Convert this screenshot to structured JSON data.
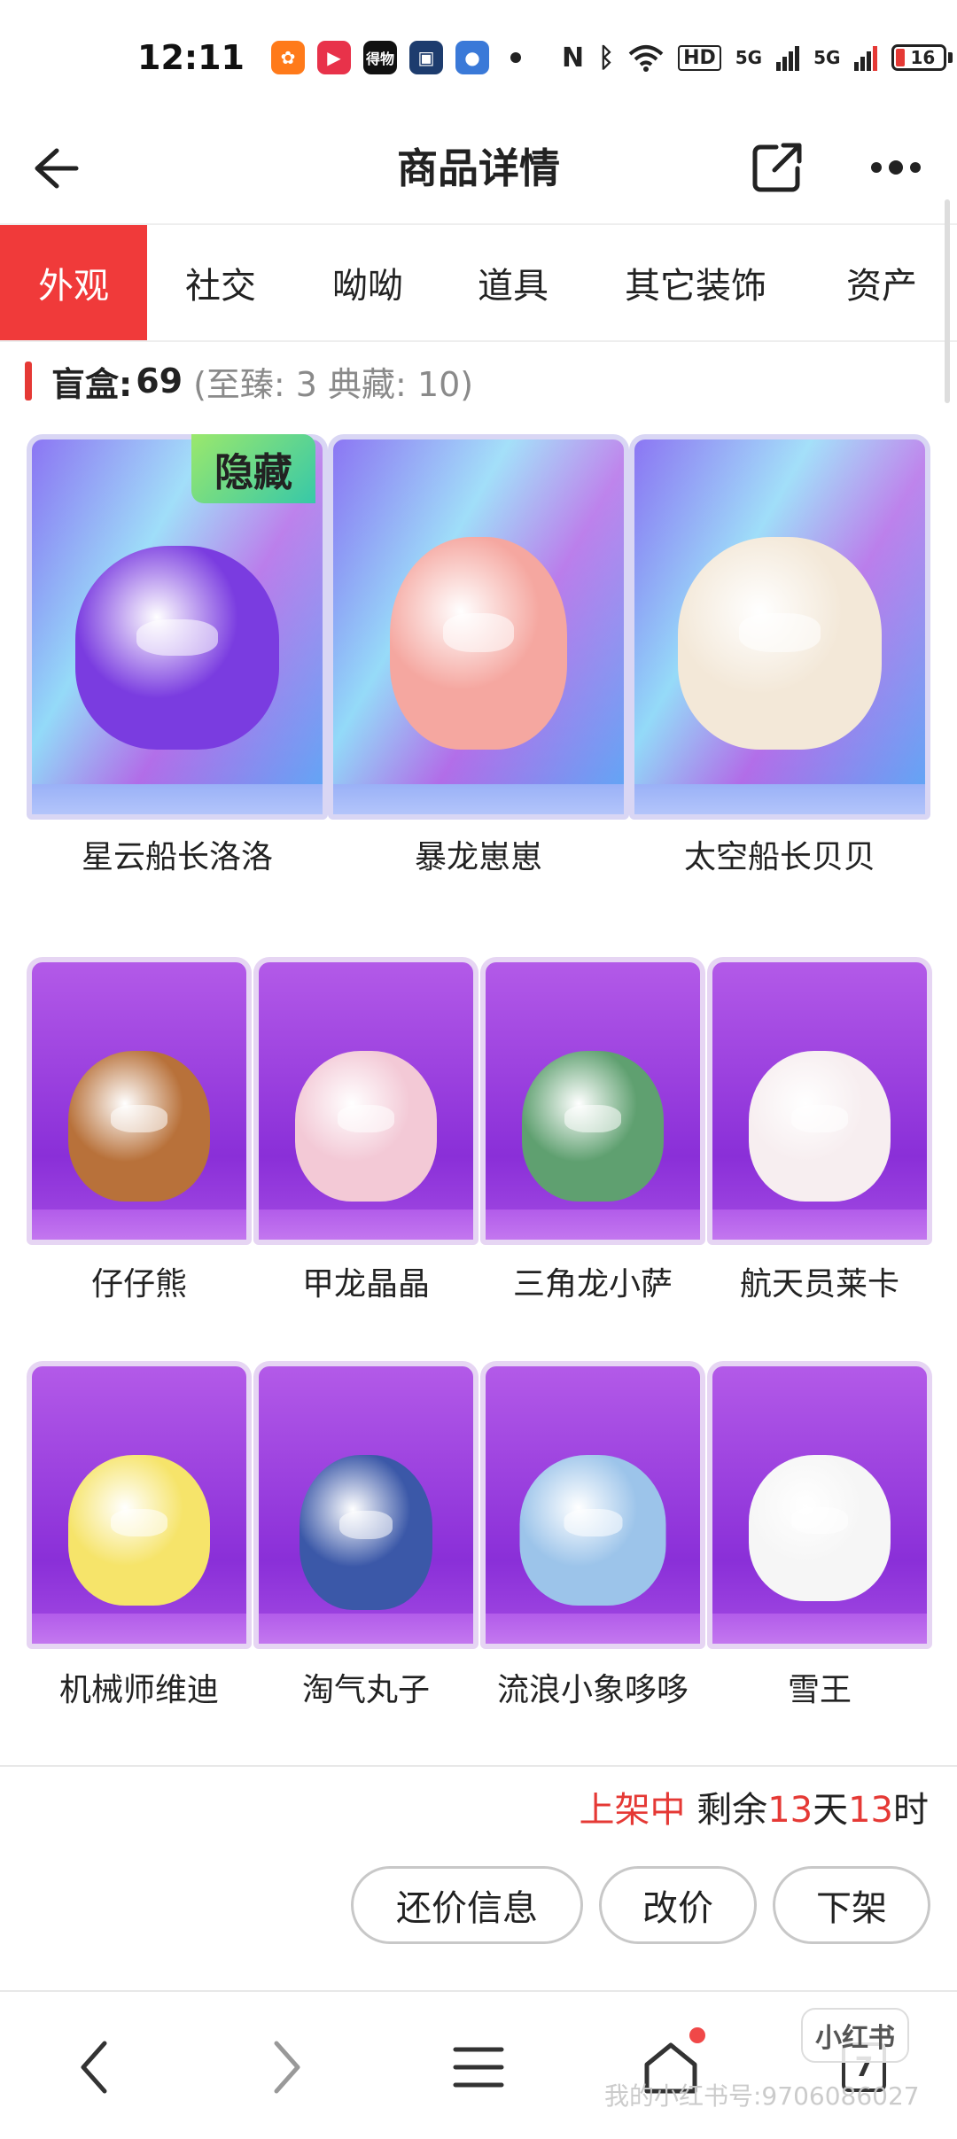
{
  "status_bar": {
    "time": "12:11",
    "apps": [
      {
        "icon": "kuaishou-icon",
        "glyph": "✿",
        "color": "#ff7a1a"
      },
      {
        "icon": "video-play-icon",
        "glyph": "▶",
        "color": "#e8324a"
      },
      {
        "icon": "dewu-icon",
        "glyph": "得物",
        "color": "#111111"
      },
      {
        "icon": "news-app-icon",
        "glyph": "▣",
        "color": "#1d3c6e"
      },
      {
        "icon": "game-app-icon",
        "glyph": "●",
        "color": "#3a79d8"
      }
    ],
    "signal_text_1": "5G",
    "signal_text_2": "5G",
    "hd_label": "HD",
    "battery": "16",
    "battery_color": "#e53935"
  },
  "header": {
    "title": "商品详情"
  },
  "tabs": [
    {
      "label": "外观",
      "active": true
    },
    {
      "label": "社交",
      "active": false
    },
    {
      "label": "呦呦",
      "active": false
    },
    {
      "label": "道具",
      "active": false
    },
    {
      "label": "其它装饰",
      "active": false
    },
    {
      "label": "资产",
      "active": false
    }
  ],
  "summary": {
    "label": "盲盒:",
    "value": "69",
    "extra": "(至臻: 3 典藏: 10)"
  },
  "featured_items": [
    {
      "name": "星云船长洛洛",
      "badge": "隐藏",
      "figure_color": "#7a3ce0"
    },
    {
      "name": "暴龙崽崽",
      "badge": "",
      "figure_color": "#f5a7a0"
    },
    {
      "name": "太空船长贝贝",
      "badge": "",
      "figure_color": "#f3e8d8"
    }
  ],
  "items_row_2": [
    {
      "name": "仔仔熊",
      "figure_color": "#b8713a"
    },
    {
      "name": "甲龙晶晶",
      "figure_color": "#f3c9d6"
    },
    {
      "name": "三角龙小萨",
      "figure_color": "#5fa070"
    },
    {
      "name": "航天员莱卡",
      "figure_color": "#f7eef0"
    }
  ],
  "items_row_3": [
    {
      "name": "机械师维迪",
      "figure_color": "#f6e46a"
    },
    {
      "name": "淘气丸子",
      "figure_color": "#3b58a8"
    },
    {
      "name": "流浪小象哆哆",
      "figure_color": "#9cc4ea"
    },
    {
      "name": "雪王",
      "figure_color": "#f6f6f6"
    }
  ],
  "sale": {
    "status": "上架中",
    "remaining_prefix": "剩余",
    "days": "13",
    "day_unit": "天",
    "hours": "13",
    "hour_unit": "时"
  },
  "actions": {
    "bargain": "还价信息",
    "reprice": "改价",
    "delist": "下架"
  },
  "watermark": {
    "logo": "小红书",
    "text": "我的小红书号:9706086027"
  },
  "navbar": {
    "tab_count": "7"
  }
}
